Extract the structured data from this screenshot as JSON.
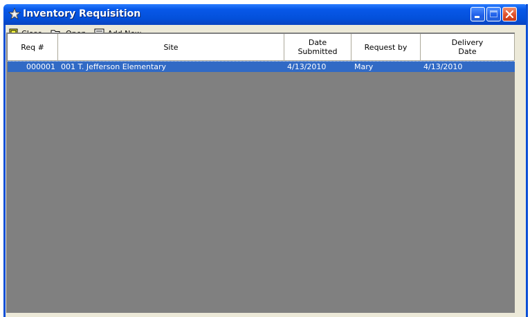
{
  "window": {
    "title": "Inventory Requisition"
  },
  "toolbar": {
    "close_label": "Close",
    "close_accel": "C",
    "close_rest": "lose",
    "open_label": "Open",
    "add_new_label": "Add New",
    "add_new_accel": "A",
    "add_new_rest": "dd New"
  },
  "table": {
    "columns": [
      "Req #",
      "Site",
      "Date Submitted",
      "Request by",
      "Delivery Date"
    ],
    "rows": [
      {
        "req": "000001",
        "site": "001 T. Jefferson Elementary",
        "date_submitted": "4/13/2010",
        "request_by": "Mary",
        "delivery_date": "4/13/2010"
      }
    ]
  },
  "colors": {
    "title_bar": "#0a4fd6",
    "selection": "#316ac5",
    "grid_background": "#808080",
    "face": "#ece9d8"
  },
  "icons": [
    "star-app-icon",
    "minimize-icon",
    "maximize-icon",
    "close-icon",
    "close-door-icon",
    "open-folder-icon",
    "list-add-icon"
  ]
}
